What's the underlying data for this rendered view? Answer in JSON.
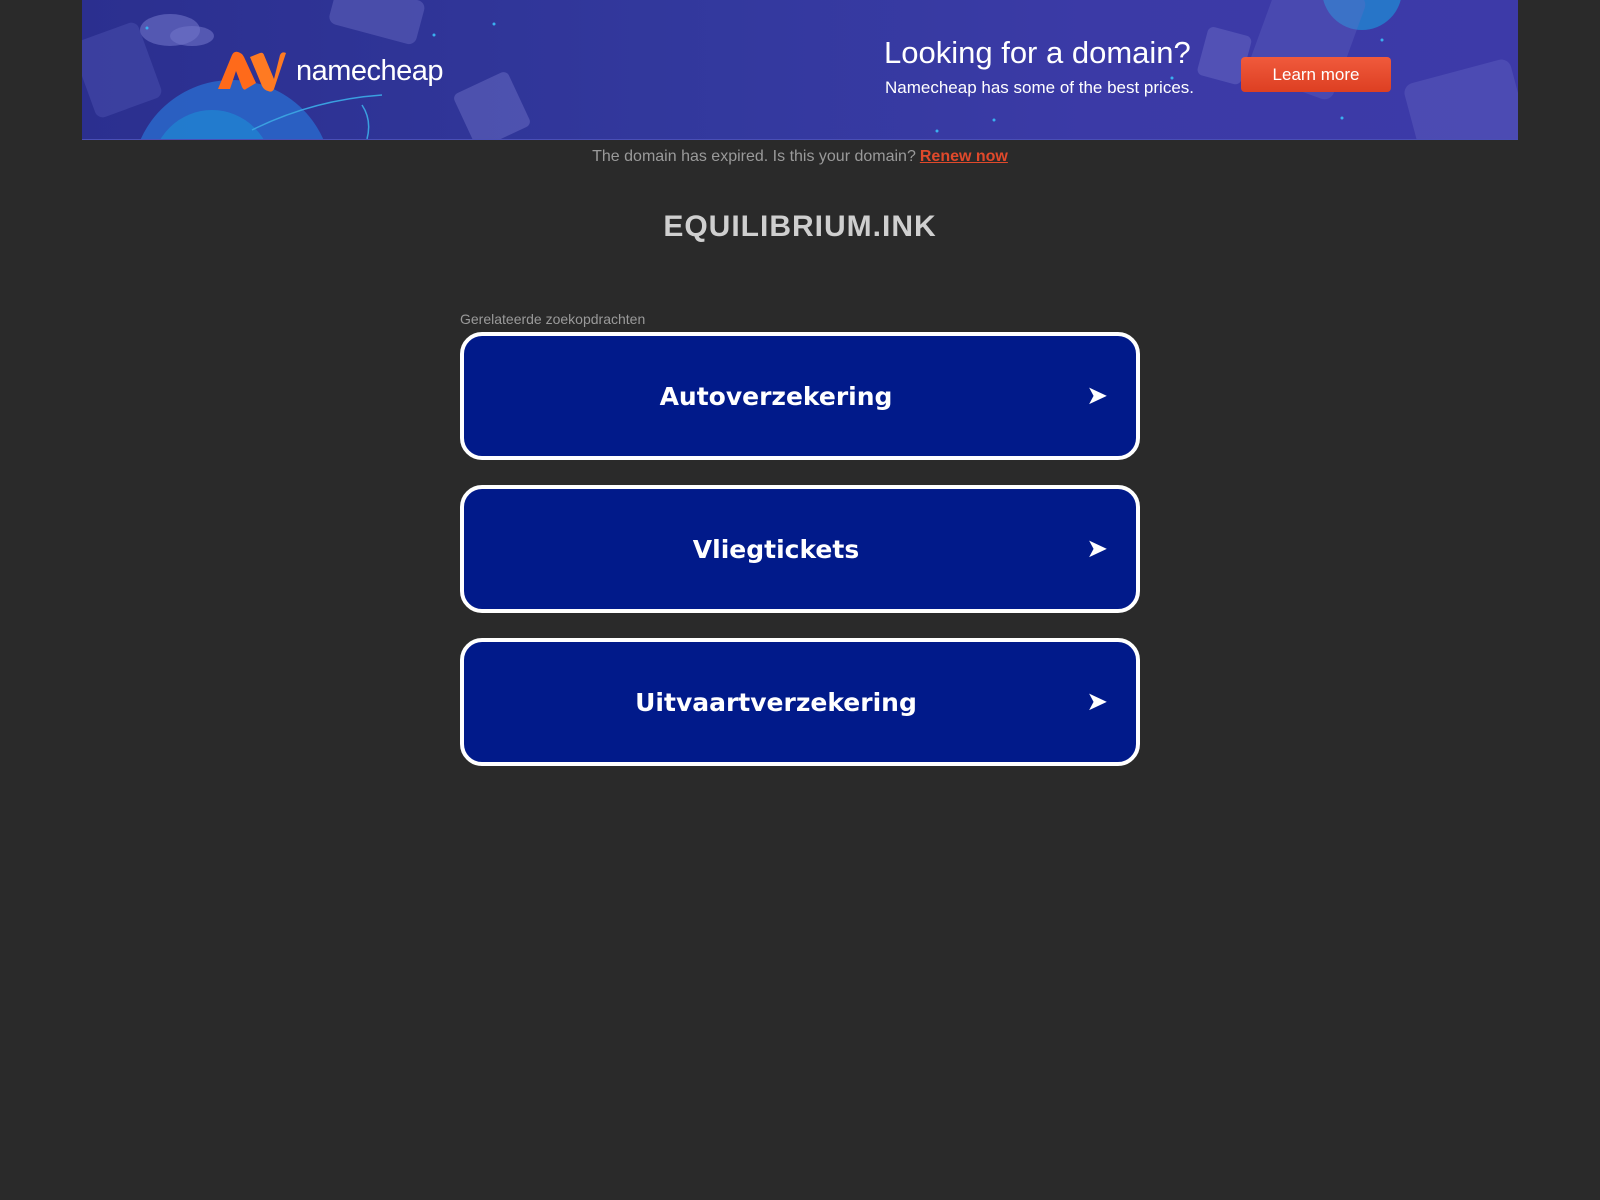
{
  "banner": {
    "logo_text": "namecheap",
    "title": "Looking for a domain?",
    "subtitle": "Namecheap has some of the best prices.",
    "cta_label": "Learn more"
  },
  "notice": {
    "text": "The domain has expired. Is this your domain?",
    "link_label": "Renew now"
  },
  "domain": {
    "name": "EQUILIBRIUM.INK"
  },
  "related": {
    "label": "Gerelateerde zoekopdrachten",
    "items": [
      {
        "label": "Autoverzekering",
        "icon": "arrow-right-icon"
      },
      {
        "label": "Vliegtickets",
        "icon": "arrow-right-icon"
      },
      {
        "label": "Uitvaartverzekering",
        "icon": "arrow-right-icon"
      }
    ]
  },
  "colors": {
    "page_background": "#2a2a2a",
    "banner_background": "#33399e",
    "cta_background": "#e8492b",
    "renew_link": "#e0492b",
    "button_background": "#011a8a",
    "button_border": "#ffffff",
    "logo_orange": "#ff6a1a"
  }
}
